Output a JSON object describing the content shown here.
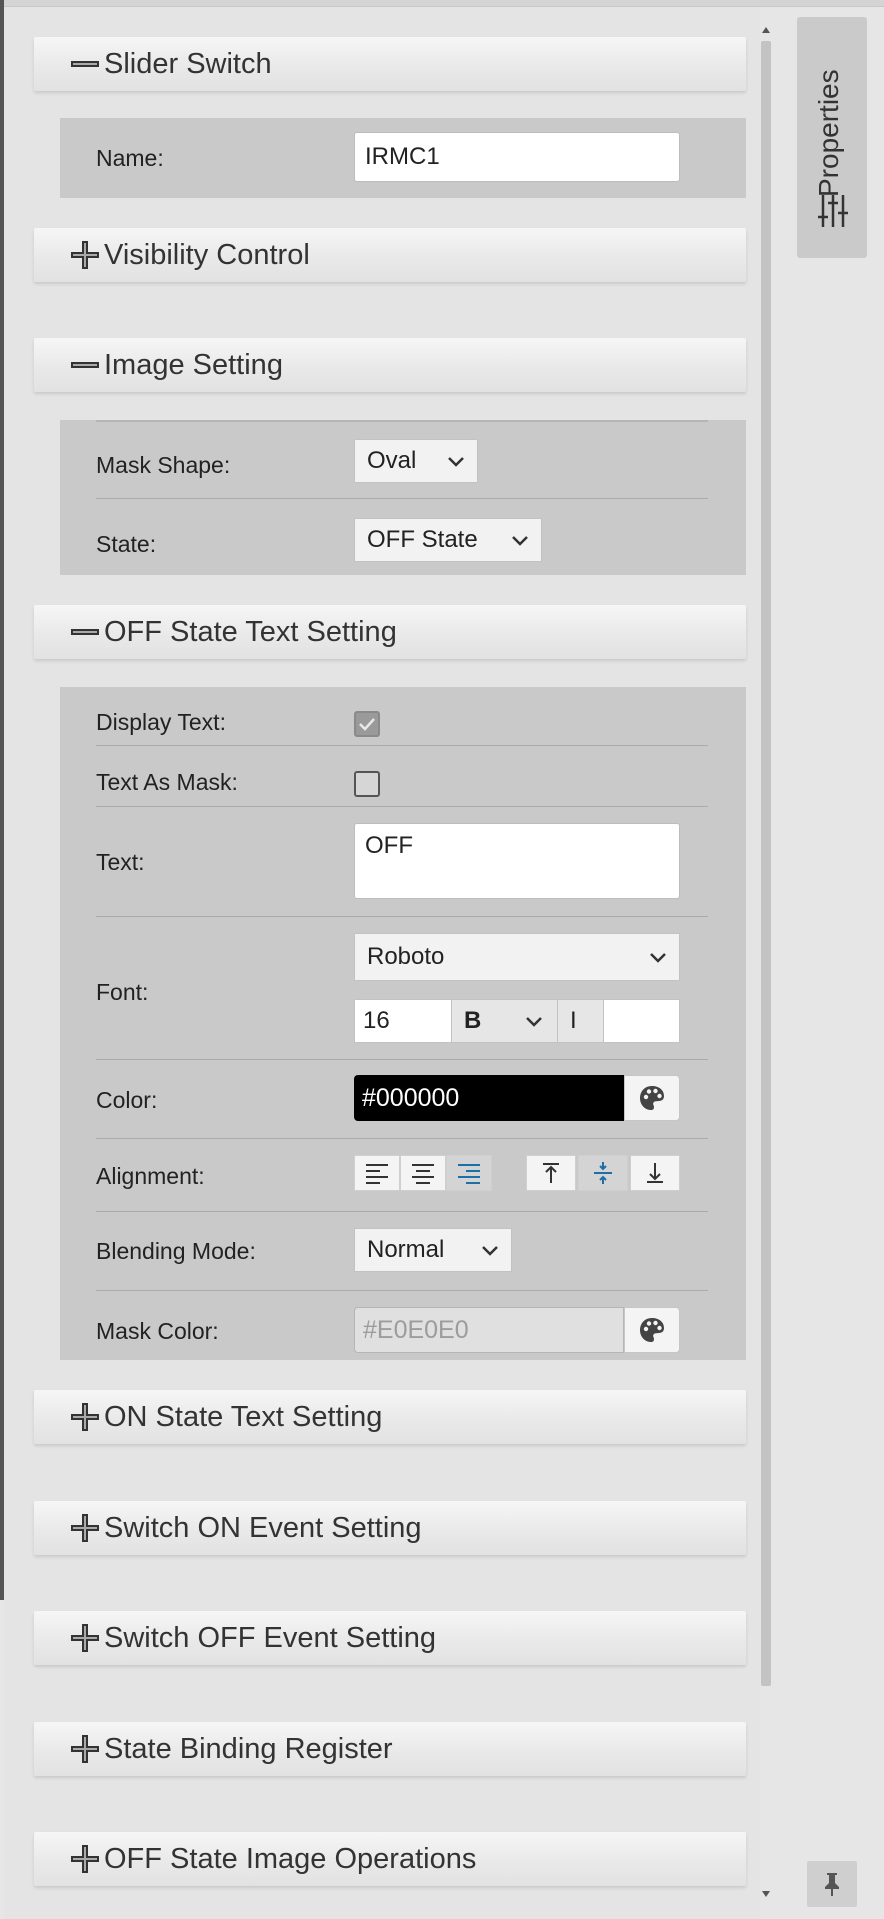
{
  "sections": {
    "slider_switch": {
      "title": "Slider Switch",
      "expanded": true,
      "name_label": "Name:",
      "name_value": "IRMC1"
    },
    "visibility_control": {
      "title": "Visibility Control",
      "expanded": false
    },
    "image_setting": {
      "title": "Image Setting",
      "expanded": true,
      "mask_shape_label": "Mask Shape:",
      "mask_shape_value": "Oval",
      "state_label": "State:",
      "state_value": "OFF State"
    },
    "off_state_text": {
      "title": "OFF State Text Setting",
      "expanded": true,
      "display_text_label": "Display Text:",
      "display_text_checked": true,
      "text_as_mask_label": "Text As Mask:",
      "text_as_mask_checked": false,
      "text_label": "Text:",
      "text_value": "OFF",
      "font_label": "Font:",
      "font_family": "Roboto",
      "font_size": "16",
      "font_weight": "B",
      "italic_label": "I",
      "color_label": "Color:",
      "color_value": "#000000",
      "alignment_label": "Alignment:",
      "blending_label": "Blending Mode:",
      "blending_value": "Normal",
      "mask_color_label": "Mask Color:",
      "mask_color_value": "#E0E0E0"
    },
    "on_state_text": {
      "title": "ON State Text Setting",
      "expanded": false
    },
    "switch_on_event": {
      "title": "Switch ON Event Setting",
      "expanded": false
    },
    "switch_off_event": {
      "title": "Switch OFF Event Setting",
      "expanded": false
    },
    "state_binding": {
      "title": "State Binding Register",
      "expanded": false
    },
    "off_state_image_ops": {
      "title": "OFF State Image Operations",
      "expanded": false
    }
  },
  "right_rail": {
    "properties_tab_label": "Properties",
    "tab_icon": "sliders-icon",
    "pin_icon": "pin-icon"
  },
  "colors": {
    "accent": "#1d6fa5",
    "section_body": "#c9c9c9",
    "panel_bg": "#e4e4e4"
  }
}
